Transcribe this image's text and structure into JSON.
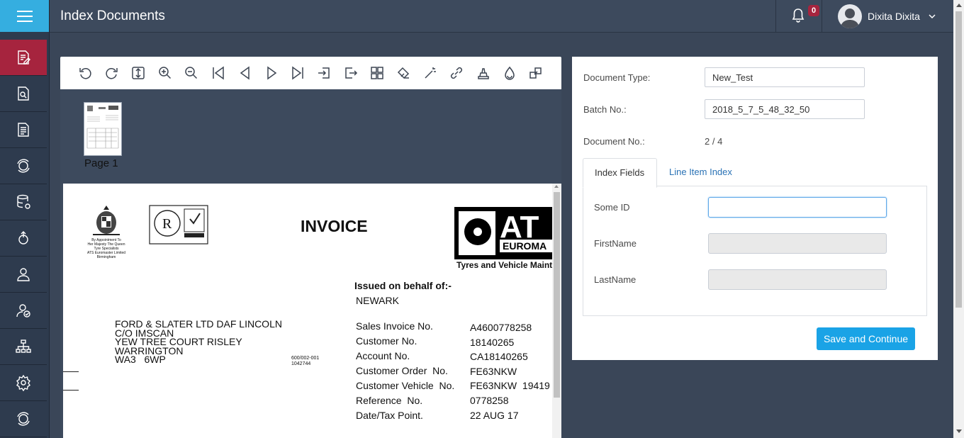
{
  "header": {
    "title": "Index Documents",
    "notification_count": "0",
    "user_name": "Dixita Dixita"
  },
  "sidebar": {
    "items": [
      {
        "icon": "edit-document-icon",
        "active": true
      },
      {
        "icon": "search-document-icon",
        "active": false
      },
      {
        "icon": "document-icon",
        "active": false
      },
      {
        "icon": "sync-icon",
        "active": false
      },
      {
        "icon": "database-sync-icon",
        "active": false
      },
      {
        "icon": "upload-gear-icon",
        "active": false
      },
      {
        "icon": "user-icon",
        "active": false
      },
      {
        "icon": "user-check-icon",
        "active": false
      },
      {
        "icon": "hierarchy-icon",
        "active": false
      },
      {
        "icon": "settings-icon",
        "active": false
      },
      {
        "icon": "sync-icon",
        "active": false
      }
    ]
  },
  "viewer": {
    "toolbar": [
      "rotate-left-icon",
      "rotate-right-icon",
      "fit-height-icon",
      "zoom-in-icon",
      "zoom-out-icon",
      "first-page-icon",
      "previous-page-icon",
      "next-page-icon",
      "last-page-icon",
      "import-icon",
      "export-icon",
      "thumbnails-grid-icon",
      "eraser-icon",
      "magic-wand-icon",
      "link-icon",
      "stamp-icon",
      "flame-icon",
      "move-icon"
    ],
    "thumbnail_label": "Page 1",
    "document": {
      "title": "INVOICE",
      "royal_warrant": [
        "By Appointment To",
        "Her Majesty The Queen",
        "Tyre Specialists",
        "ATS Euromaster Limited",
        "Birmingham"
      ],
      "logo_text": [
        "AT",
        "EUROMA"
      ],
      "tagline": "Tyres and Vehicle Maint",
      "issued_on_behalf_label": "Issued on behalf of:-",
      "issued_on_behalf_value": "NEWARK",
      "address": [
        "FORD & SLATER LTD DAF LINCOLN",
        "C/O IMSCAN",
        "YEW TREE COURT RISLEY",
        "WARRINGTON",
        "WA3   6WP"
      ],
      "small_code": [
        "600/002-001",
        "1042744"
      ],
      "fields": [
        {
          "label": "Sales Invoice No.",
          "value": "A4600778258"
        },
        {
          "label": "Customer No.",
          "value": "18140265"
        },
        {
          "label": "Account No.",
          "value": "CA18140265"
        },
        {
          "label": "Customer Order  No.",
          "value": "FE63NKW"
        },
        {
          "label": "Customer Vehicle  No.",
          "value": "FE63NKW  19419"
        },
        {
          "label": "Reference  No.",
          "value": "0778258"
        },
        {
          "label": "Date/Tax Point.",
          "value": "22 AUG 17"
        }
      ]
    }
  },
  "panel": {
    "document_type_label": "Document Type:",
    "document_type_value": "New_Test",
    "batch_no_label": "Batch No.:",
    "batch_no_value": "2018_5_7_5_48_32_50",
    "document_no_label": "Document No.:",
    "document_no_value": "2 / 4",
    "tabs": [
      {
        "label": "Index Fields",
        "active": true
      },
      {
        "label": "Line Item Index",
        "active": false
      }
    ],
    "fields": [
      {
        "label": "Some ID",
        "value": ""
      },
      {
        "label": "FirstName",
        "value": ""
      },
      {
        "label": "LastName",
        "value": ""
      }
    ],
    "save_button": "Save and Continue"
  },
  "colors": {
    "sidebar": "#2e3b4e",
    "menu_accent": "#35aee0",
    "active_item": "#a6243e",
    "header": "#3d4a5d",
    "primary_button": "#1aa3e6",
    "tab_link": "#2a72b5"
  }
}
